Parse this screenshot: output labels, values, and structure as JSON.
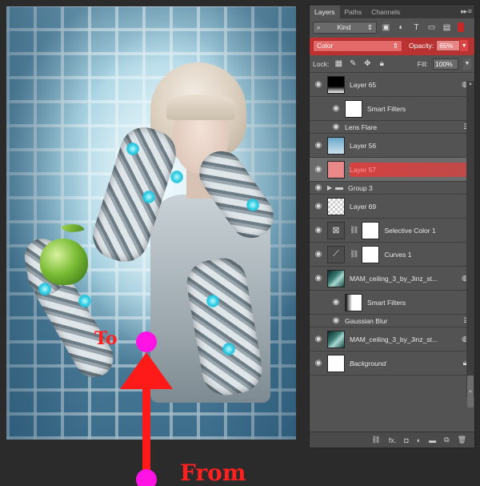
{
  "tabs": [
    {
      "label": "Layers",
      "active": true
    },
    {
      "label": "Paths",
      "active": false
    },
    {
      "label": "Channels",
      "active": false
    }
  ],
  "filter": {
    "kind": "Kind"
  },
  "blend": {
    "mode": "Color",
    "opacity_label": "Opacity:",
    "opacity_value": "65%"
  },
  "lock_row": {
    "lock_label": "Lock:",
    "fill_label": "Fill:",
    "fill_value": "100%"
  },
  "layers": [
    {
      "name": "Layer 65"
    },
    {
      "name": "Smart Filters"
    },
    {
      "name": "Lens Flare"
    },
    {
      "name": "Layer 56"
    },
    {
      "name": "Layer 57"
    },
    {
      "name": "Group 3"
    },
    {
      "name": "Layer 69"
    },
    {
      "name": "Selective Color 1"
    },
    {
      "name": "Curves 1"
    },
    {
      "name": "MAM_ceiling_3_by_Jinz_st..."
    },
    {
      "name": "Smart Filters"
    },
    {
      "name": "Gaussian Blur"
    },
    {
      "name": "MAM_ceiling_3_by_Jinz_st..."
    },
    {
      "name": "Background"
    }
  ],
  "annotation": {
    "to_label": "To",
    "from_label": "From",
    "arrow_color": "#ff1a1a",
    "dot_color": "#ff12e4"
  },
  "colors": {
    "panel_bg": "#535353",
    "highlight": "#e03c3c"
  }
}
